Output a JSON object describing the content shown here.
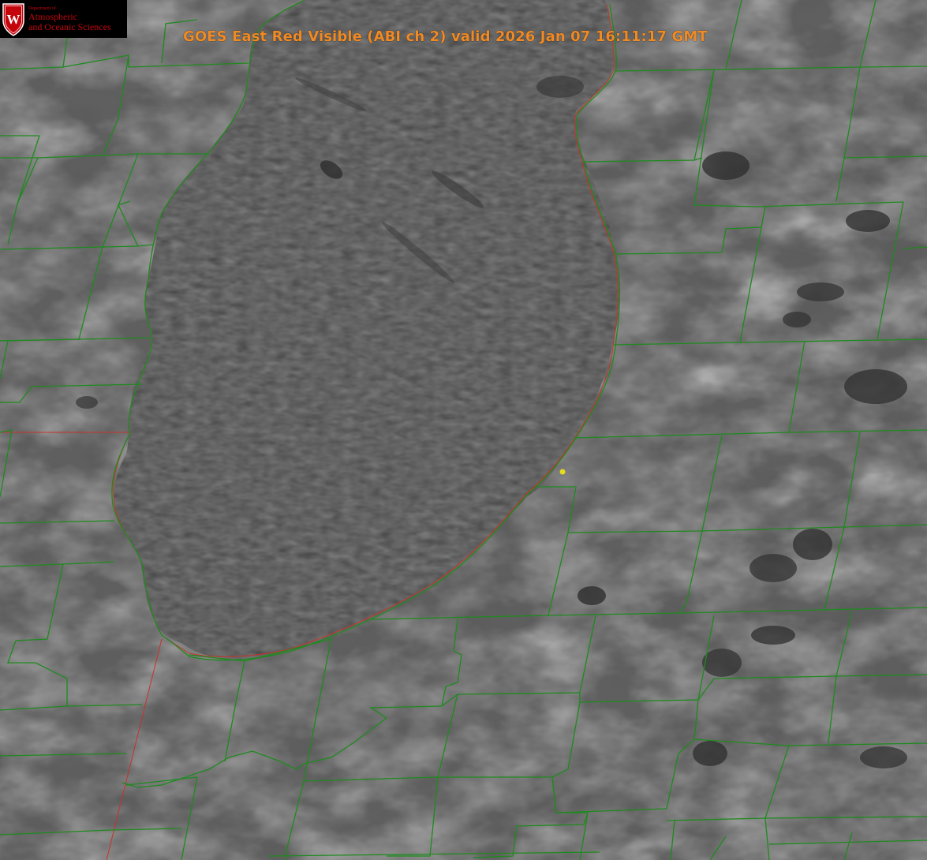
{
  "title": "GOES East Red Visible (ABI ch 2) valid 2026 Jan 07 16:11:17 GMT",
  "logo": {
    "department": "Department of",
    "line1": "Atmospheric",
    "line2": "and Oceanic Sciences",
    "emblem_letter": "W",
    "emblem_color": "#c5050c"
  },
  "map": {
    "imagery": "visible satellite (grayscale)",
    "county_boundary_color": "#1e8a1e",
    "state_boundary_color": "#c8322a",
    "marker_color": "#e6dc1e",
    "lake": "Lake Michigan (southern basin)"
  }
}
